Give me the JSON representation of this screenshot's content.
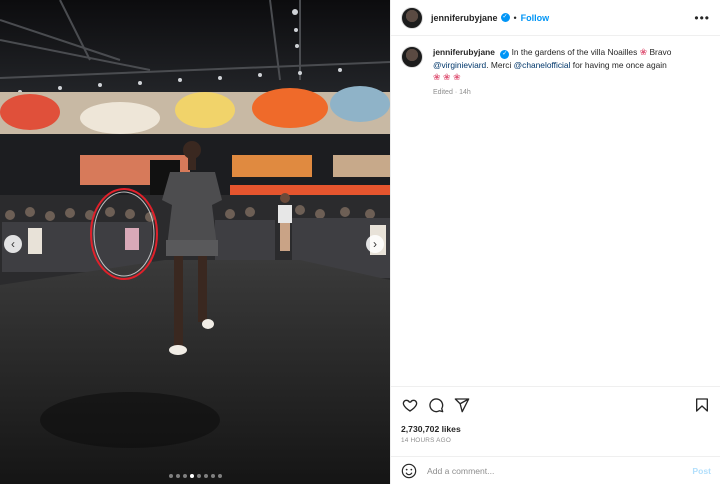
{
  "post": {
    "username": "jenniferubyjane",
    "follow_label": "Follow",
    "caption": {
      "text_1": "In the gardens of the villa Noailles ",
      "flower_1": "❀",
      "text_2": " Bravo ",
      "mention_1": "@virginieviard",
      "text_3": ". Merci ",
      "mention_2": "@chanelofficial",
      "text_4": " for having me once again",
      "flowers_2": "❀ ❀ ❀"
    },
    "edited_label": "Edited",
    "edited_age": "14h",
    "likes": "2,730,702 likes",
    "time_ago": "14 HOURS AGO"
  },
  "comment": {
    "placeholder": "Add a comment...",
    "post_label": "Post"
  },
  "media": {
    "dot_count": 8,
    "active_dot": 3
  },
  "colors": {
    "accent": "#0095f6",
    "mention": "#00376b",
    "muted": "#8e8e8e",
    "circle_annotation": "#e0202a"
  },
  "icons": {
    "like": "heart-icon",
    "comment": "comment-icon",
    "share": "share-icon",
    "save": "bookmark-icon",
    "emoji": "smiley-icon",
    "options": "more-options-icon",
    "verified": "verified-badge-icon"
  }
}
